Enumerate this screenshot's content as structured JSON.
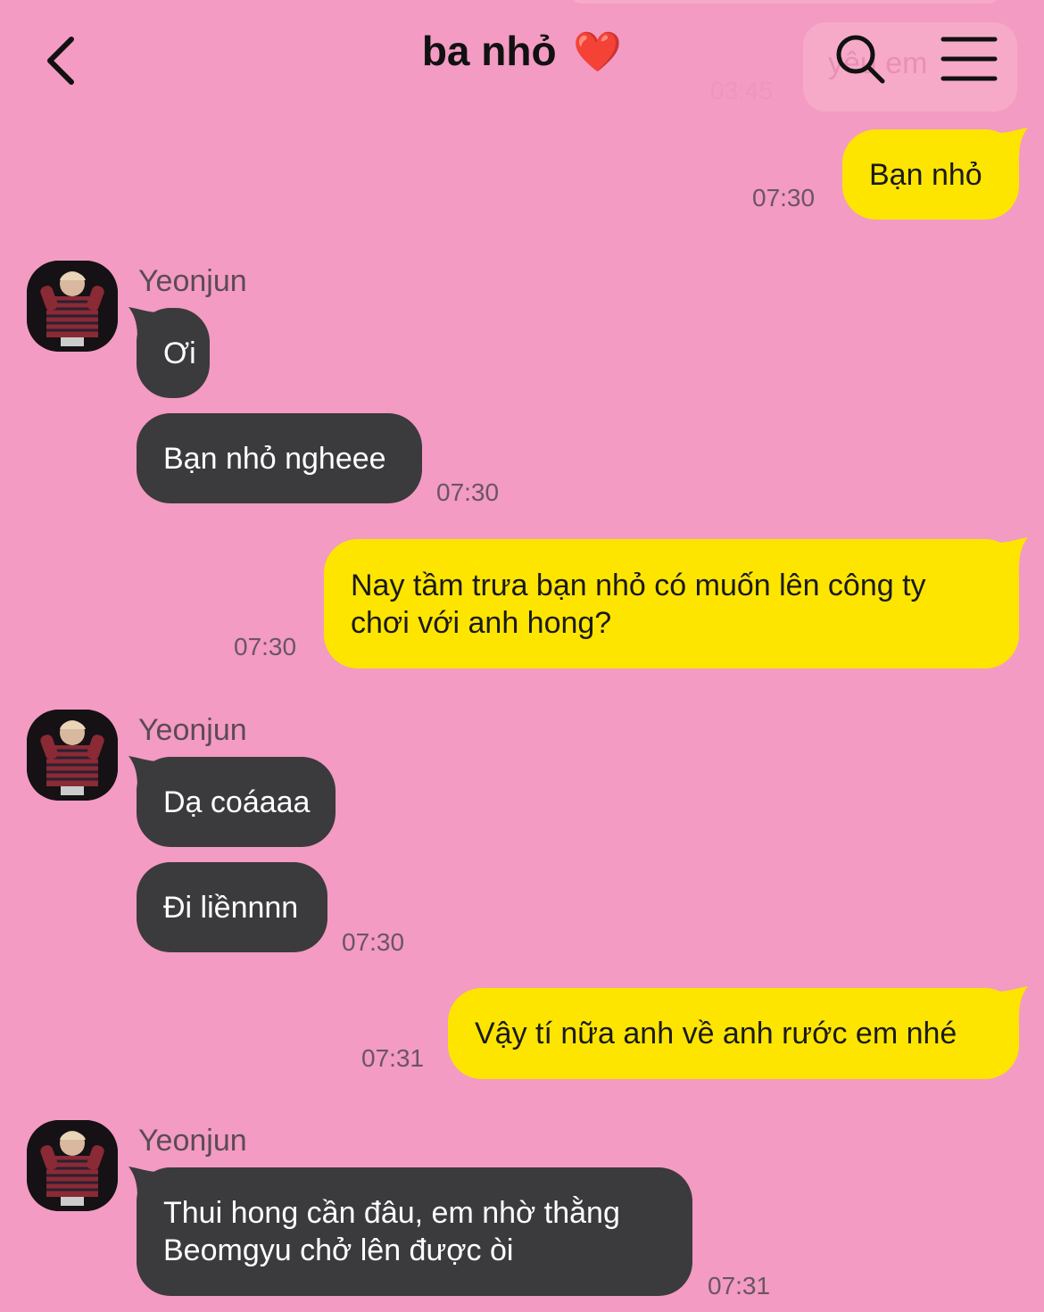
{
  "header": {
    "title": "ba nhỏ",
    "title_emoji": "❤️"
  },
  "ghost": {
    "text": "yêu em",
    "time": "03:45"
  },
  "messages": [
    {
      "side": "out",
      "text": "Bạn nhỏ",
      "time": "07:30"
    },
    {
      "side": "in",
      "sender": "Yeonjun",
      "texts": [
        "Ơi",
        "Bạn nhỏ ngheee"
      ],
      "time": "07:30"
    },
    {
      "side": "out",
      "text": "Nay tầm trưa bạn nhỏ có muốn lên công ty chơi với anh hong?",
      "time": "07:30"
    },
    {
      "side": "in",
      "sender": "Yeonjun",
      "texts": [
        "Dạ coáaaa",
        "Đi liềnnnn"
      ],
      "time": "07:30"
    },
    {
      "side": "out",
      "text": "Vậy tí nữa anh về anh rước em nhé",
      "time": "07:31"
    },
    {
      "side": "in",
      "sender": "Yeonjun",
      "texts": [
        "Thui hong cần đâu, em nhờ thằng Beomgyu chở lên được òi"
      ],
      "time": "07:31"
    }
  ],
  "colors": {
    "background": "#f39bc2",
    "outgoing_bubble": "#fee500",
    "incoming_bubble": "#3b3a3d"
  }
}
